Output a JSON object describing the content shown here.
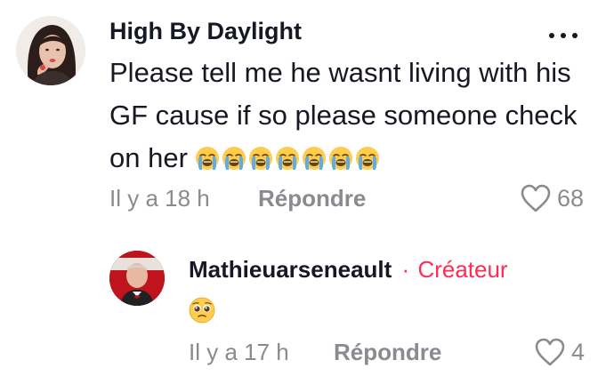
{
  "comments": [
    {
      "username": "High By Daylight",
      "text": "Please tell me he wasnt living with his GF cause if so please someone check on her",
      "emoji_icons": [
        "loudly-crying-face-icon",
        "loudly-crying-face-icon",
        "loudly-crying-face-icon",
        "loudly-crying-face-icon",
        "loudly-crying-face-icon",
        "loudly-crying-face-icon",
        "loudly-crying-face-icon"
      ],
      "time": "Il y a 18 h",
      "reply_label": "Répondre",
      "likes": "68"
    },
    {
      "username": "Mathieuarseneault",
      "separator": "·",
      "creator_badge": "Créateur",
      "emoji_icon": "pleading-face-icon",
      "time": "Il y a 17 h",
      "reply_label": "Répondre",
      "likes": "4"
    }
  ],
  "colors": {
    "creator": "#fe2c55",
    "muted": "#8a8b91",
    "text": "#161823"
  }
}
